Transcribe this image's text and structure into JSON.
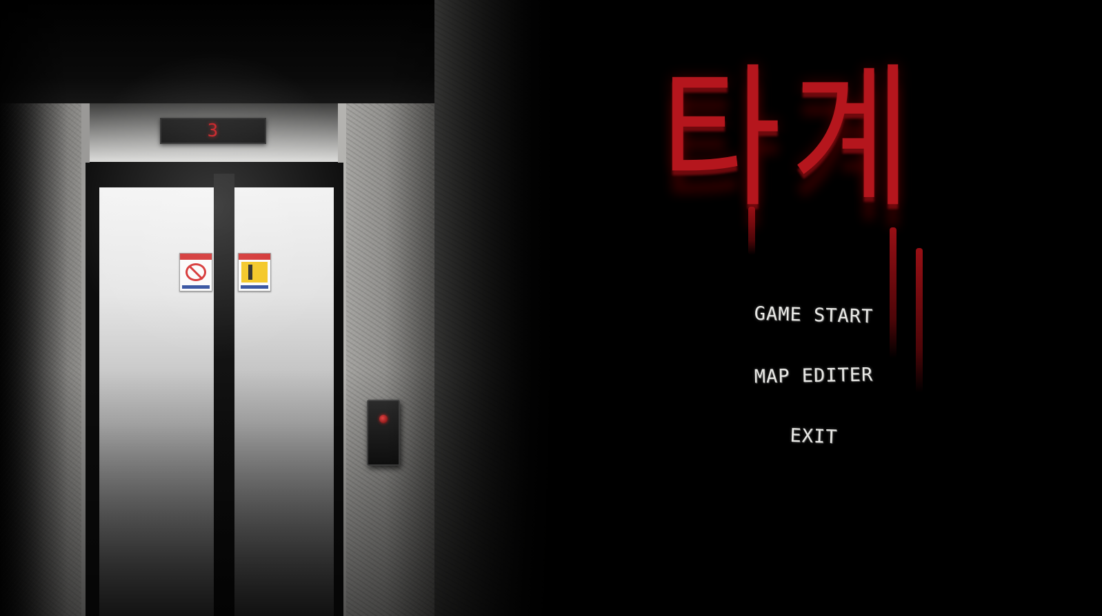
{
  "game": {
    "title": "타계",
    "title_color": "#b5161d"
  },
  "environment": {
    "floor_indicator": "3",
    "floor_indicator_color": "#c6171c",
    "call_button_color": "#ff4b4b"
  },
  "menu": {
    "items": [
      {
        "label": "GAME START"
      },
      {
        "label": "MAP EDITER"
      },
      {
        "label": "EXIT"
      }
    ],
    "text_color": "#e9e9e6"
  }
}
